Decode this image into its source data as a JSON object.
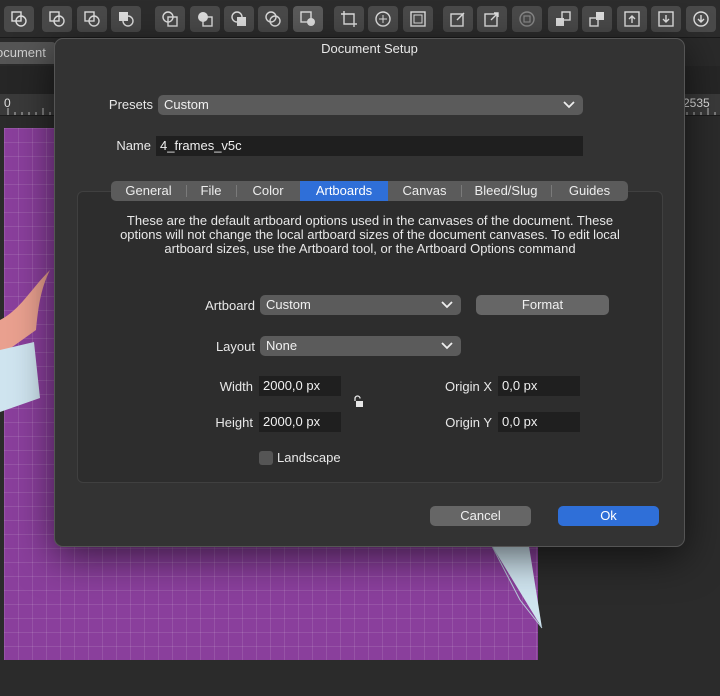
{
  "background": {
    "doc_tab_label": "ocument",
    "ruler": {
      "left_label": "0",
      "right_label": "2535"
    },
    "artboard_color": "#8a3f9c"
  },
  "dialog": {
    "title": "Document Setup",
    "presets": {
      "label": "Presets",
      "value": "Custom"
    },
    "name": {
      "label": "Name",
      "value": "4_frames_v5c"
    },
    "tabs": [
      {
        "label": "General",
        "active": false
      },
      {
        "label": "File",
        "active": false
      },
      {
        "label": "Color",
        "active": false
      },
      {
        "label": "Artboards",
        "active": true
      },
      {
        "label": "Canvas",
        "active": false
      },
      {
        "label": "Bleed/Slug",
        "active": false
      },
      {
        "label": "Guides",
        "active": false
      }
    ],
    "artboards": {
      "description_lines": [
        "These are the default artboard options used in the canvases of the document. These",
        "options will not change the local artboard sizes of the document canvases. To edit local",
        "artboard sizes, use the Artboard tool, or the Artboard Options command"
      ],
      "artboard": {
        "label": "Artboard",
        "value": "Custom"
      },
      "format_button": "Format",
      "layout": {
        "label": "Layout",
        "value": "None"
      },
      "width": {
        "label": "Width",
        "value": "2000,0 px"
      },
      "height": {
        "label": "Height",
        "value": "2000,0 px"
      },
      "origin_x": {
        "label": "Origin X",
        "value": "0,0 px"
      },
      "origin_y": {
        "label": "Origin Y",
        "value": "0,0 px"
      },
      "landscape": {
        "label": "Landscape",
        "checked": false
      }
    },
    "buttons": {
      "cancel": "Cancel",
      "ok": "Ok"
    },
    "accent_color": "#2f6fd8"
  }
}
